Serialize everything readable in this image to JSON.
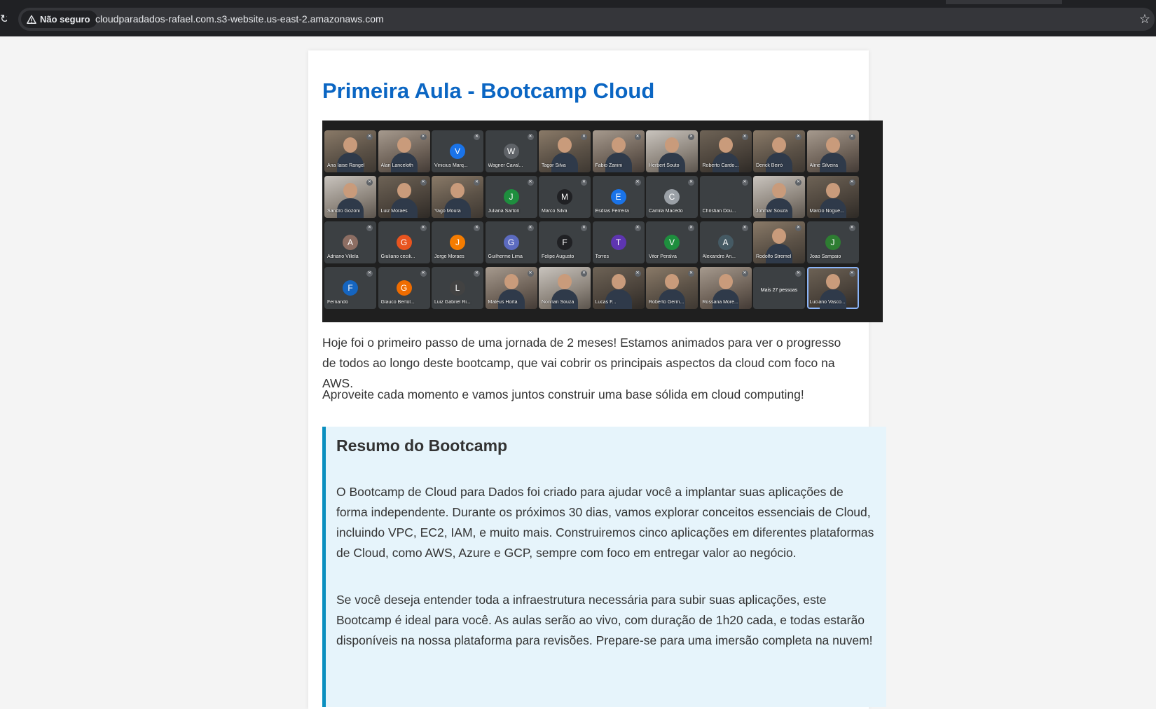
{
  "browser": {
    "security_label": "Não seguro",
    "url": "cloudparadados-rafael.com.s3-website.us-east-2.amazonaws.com"
  },
  "page": {
    "title": "Primeira Aula - Bootcamp Cloud",
    "paragraphs": [
      "Hoje foi o primeiro passo de uma jornada de 2 meses! Estamos animados para ver o progresso de todos ao longo deste bootcamp, que vai cobrir os principais aspectos da cloud com foco na AWS.",
      "Aproveite cada momento e vamos juntos construir uma base sólida em cloud computing!"
    ],
    "summary": {
      "heading": "Resumo do Bootcamp",
      "paragraphs": [
        "O Bootcamp de Cloud para Dados foi criado para ajudar você a implantar suas aplicações de forma independente. Durante os próximos 30 dias, vamos explorar conceitos essenciais de Cloud, incluindo VPC, EC2, IAM, e muito mais. Construiremos cinco aplicações em diferentes plataformas de Cloud, como AWS, Azure e GCP, sempre com foco em entregar valor ao negócio.",
        "Se você deseja entender toda a infraestrutura necessária para subir suas aplicações, este Bootcamp é ideal para você. As aulas serão ao vivo, com duração de 1h20 cada, e todas estarão disponíveis na nossa plataforma para revisões. Prepare-se para uma imersão completa na nuvem!"
      ]
    }
  },
  "meeting_photo": {
    "participants": [
      {
        "name": "Ana Iaise Rangel",
        "kind": "video"
      },
      {
        "name": "Alan Lanceloth",
        "kind": "video"
      },
      {
        "name": "Vinicius Marq...",
        "kind": "avatar",
        "letter": "V",
        "color": "#1a73e8"
      },
      {
        "name": "Wagner Caval...",
        "kind": "avatar",
        "letter": "W",
        "color": "#5f6368"
      },
      {
        "name": "Tagor Silva",
        "kind": "video"
      },
      {
        "name": "Fabio Zanini",
        "kind": "video"
      },
      {
        "name": "Herbert Souto",
        "kind": "video"
      },
      {
        "name": "Roberto Cardo...",
        "kind": "video"
      },
      {
        "name": "Derick Beiró",
        "kind": "video"
      },
      {
        "name": "Aline Silveira",
        "kind": "video"
      },
      {
        "name": "Sandro Gozoni",
        "kind": "video"
      },
      {
        "name": "Luiz Moraes",
        "kind": "video"
      },
      {
        "name": "Yago Moura",
        "kind": "video"
      },
      {
        "name": "Juliana Sartori",
        "kind": "avatar",
        "letter": "J",
        "color": "#1e8e3e"
      },
      {
        "name": "Marco Silva",
        "kind": "avatar",
        "letter": "M",
        "color": "#202124"
      },
      {
        "name": "Esdras Ferreira",
        "kind": "avatar",
        "letter": "E",
        "color": "#1a73e8"
      },
      {
        "name": "Camila Macedo",
        "kind": "avatar",
        "letter": "C",
        "color": "#9aa0a6"
      },
      {
        "name": "Christian Dou...",
        "kind": "avatar",
        "letter": "",
        "color": "#3c4043"
      },
      {
        "name": "Johmar Souza",
        "kind": "video"
      },
      {
        "name": "Marcio Nogue...",
        "kind": "video"
      },
      {
        "name": "Adriano Villela",
        "kind": "avatar",
        "letter": "A",
        "color": "#8d6e63"
      },
      {
        "name": "Giuliano cecili...",
        "kind": "avatar",
        "letter": "G",
        "color": "#e8541f"
      },
      {
        "name": "Jorge Moraes",
        "kind": "avatar",
        "letter": "J",
        "color": "#f57c00"
      },
      {
        "name": "Guilherme Lima",
        "kind": "avatar",
        "letter": "G",
        "color": "#5c6bc0"
      },
      {
        "name": "Felipe Augusto",
        "kind": "avatar",
        "letter": "F",
        "color": "#202124"
      },
      {
        "name": "Torres",
        "kind": "avatar",
        "letter": "T",
        "color": "#5e35b1"
      },
      {
        "name": "Vitor Peralva",
        "kind": "avatar",
        "letter": "V",
        "color": "#1e8e3e"
      },
      {
        "name": "Alexandre An...",
        "kind": "avatar",
        "letter": "A",
        "color": "#455a64"
      },
      {
        "name": "Rodolfo Stremel",
        "kind": "video"
      },
      {
        "name": "Joao Sampaio",
        "kind": "avatar",
        "letter": "J",
        "color": "#2e7d32"
      },
      {
        "name": "Fernando",
        "kind": "avatar",
        "letter": "F",
        "color": "#1565c0"
      },
      {
        "name": "Glauco Bertol...",
        "kind": "avatar",
        "letter": "G",
        "color": "#ef6c00"
      },
      {
        "name": "Luiz Gabriel Ri...",
        "kind": "avatar",
        "letter": "L",
        "color": "#424242"
      },
      {
        "name": "Mateus Horta",
        "kind": "video"
      },
      {
        "name": "Nonnan Souza",
        "kind": "video"
      },
      {
        "name": "Lucas F...",
        "kind": "video"
      },
      {
        "name": "Roberto Germ...",
        "kind": "video"
      },
      {
        "name": "Rossana More...",
        "kind": "video"
      },
      {
        "name": "Mais 27 pessoas",
        "kind": "more"
      },
      {
        "name": "Luciano Vasco...",
        "kind": "video",
        "active": true
      }
    ]
  },
  "colors": {
    "title": "#0b66c3",
    "summary_background": "#e6f4fb",
    "summary_border": "#0b8fbf",
    "text": "#333333"
  },
  "icons": {
    "security": "warning-triangle-icon",
    "bookmark": "star-icon",
    "reload": "reload-icon"
  }
}
